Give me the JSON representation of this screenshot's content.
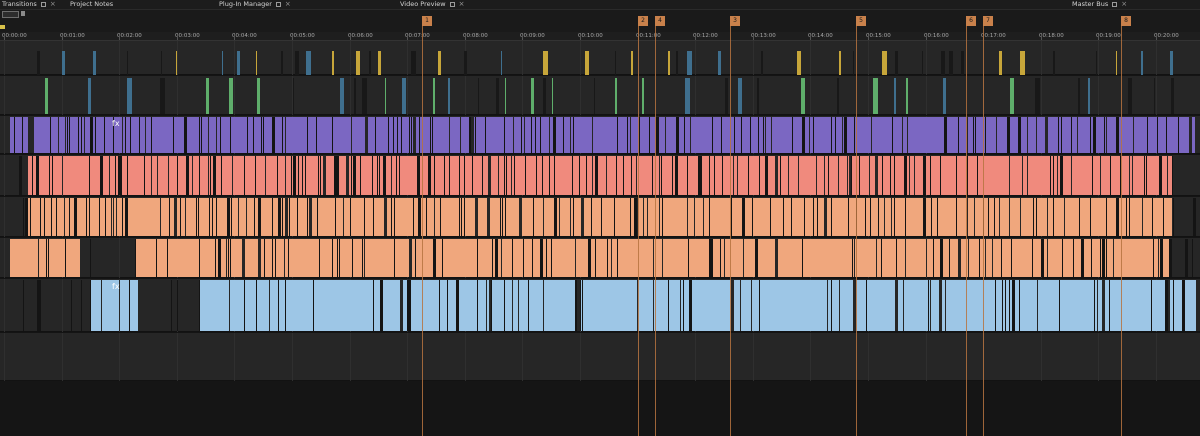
{
  "tabs": [
    {
      "label": "Transitions",
      "has_float": true,
      "has_close": true
    },
    {
      "label": "Project Notes",
      "has_float": false,
      "has_close": false
    },
    {
      "label": "Plug-In Manager",
      "has_float": true,
      "has_close": true
    },
    {
      "label": "Video Preview",
      "has_float": true,
      "has_close": true
    },
    {
      "label": "Master Bus",
      "has_float": true,
      "has_close": true
    }
  ],
  "time_labels": [
    "00:00:00",
    "00:01:00",
    "00:02:00",
    "00:03:00",
    "00:04:00",
    "00:05:00",
    "00:06:00",
    "00:07:00",
    "00:08:00",
    "00:09:00",
    "00:10:00",
    "00:11:00",
    "00:12:00",
    "00:13:00",
    "00:14:00",
    "00:15:00",
    "00:16:00",
    "00:17:00",
    "00:18:00",
    "00:19:00",
    "00:20:00"
  ],
  "markers": [
    {
      "label": "1",
      "time_min": 7.25
    },
    {
      "label": "2",
      "time_min": 11.0
    },
    {
      "label": "4",
      "time_min": 11.3
    },
    {
      "label": "3",
      "time_min": 12.6
    },
    {
      "label": "5",
      "time_min": 14.8
    },
    {
      "label": "6",
      "time_min": 16.7
    },
    {
      "label": "7",
      "time_min": 17.0
    },
    {
      "label": "8",
      "time_min": 19.4
    }
  ],
  "tracks": [
    {
      "id": "video-1",
      "color": "#262626",
      "accent": "#c7a63a"
    },
    {
      "id": "video-2",
      "color": "#262626",
      "accent": "#5fae6b"
    },
    {
      "id": "video-3",
      "color": "#7b67c2",
      "label_fx": "fx"
    },
    {
      "id": "audio-1",
      "color": "#f08a7d"
    },
    {
      "id": "audio-2",
      "color": "#f0a77d"
    },
    {
      "id": "audio-3",
      "color": "#f0a77d"
    },
    {
      "id": "audio-4",
      "color": "#9dc6e6",
      "label_fx": "fx"
    },
    {
      "id": "empty-1",
      "color": "#262626"
    }
  ],
  "colors": {
    "marker": "#c9814b",
    "background": "#141414"
  }
}
